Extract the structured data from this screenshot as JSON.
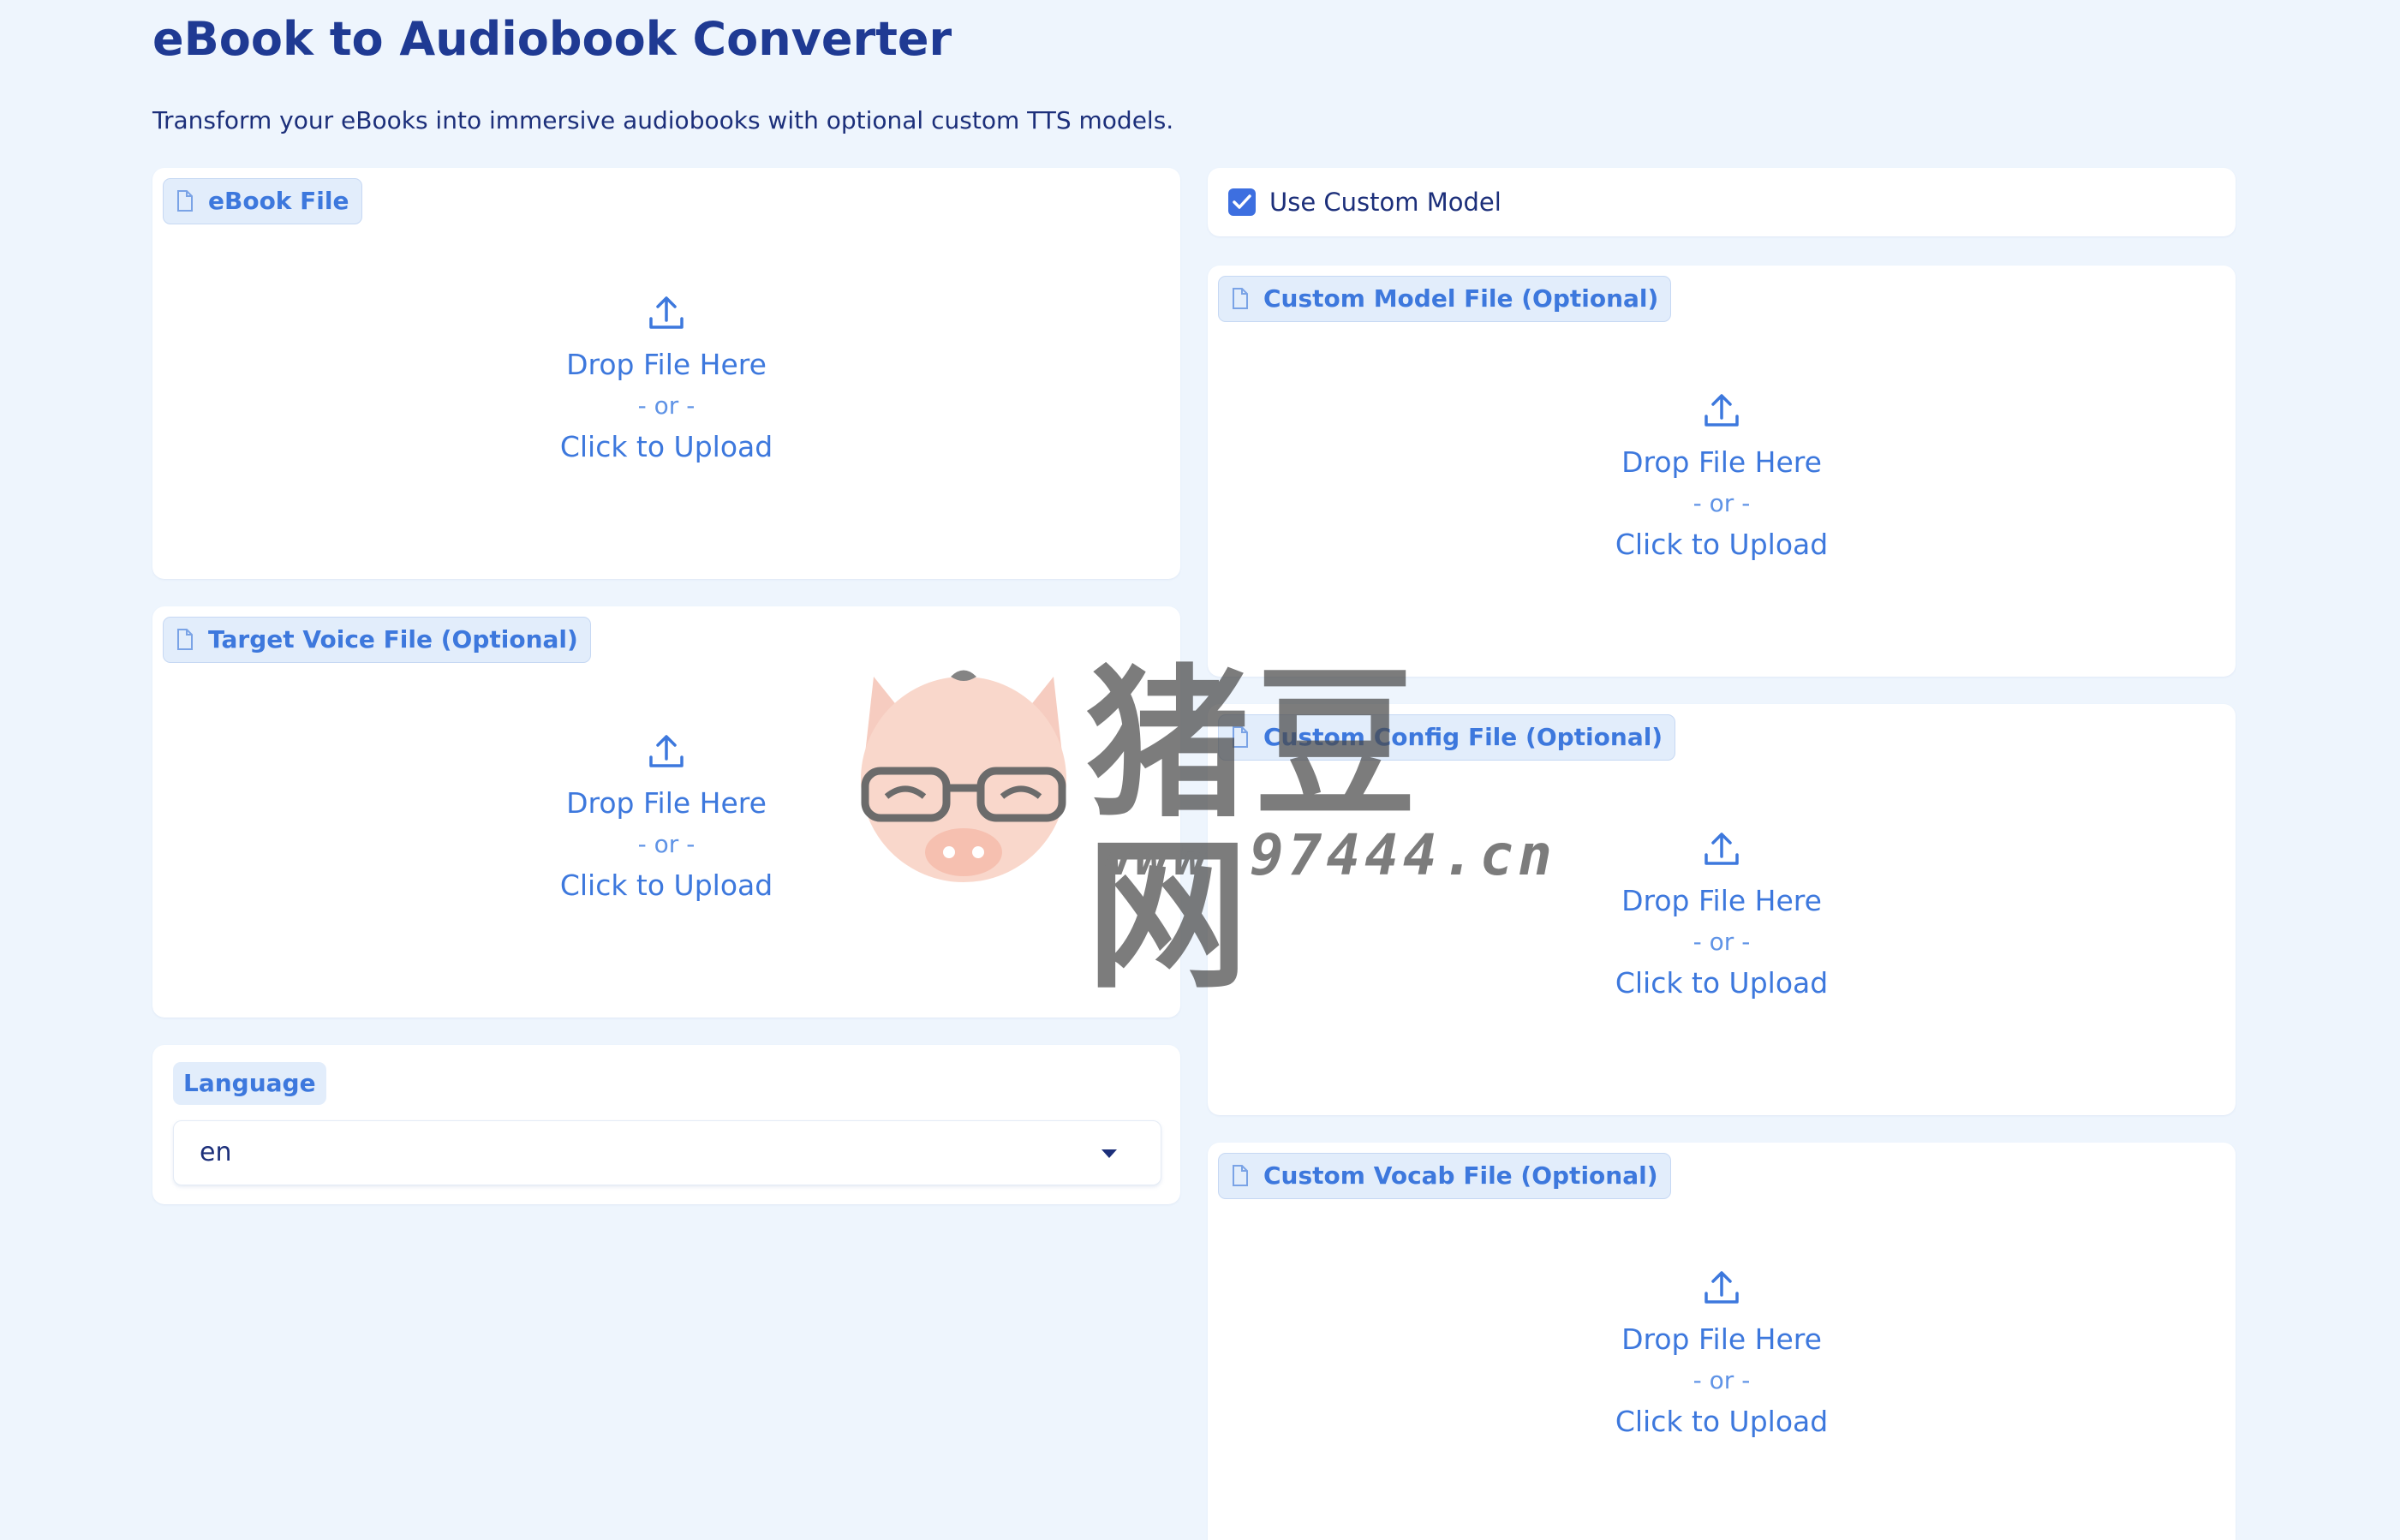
{
  "header": {
    "title": "eBook to Audiobook Converter",
    "subtitle": "Transform your eBooks into immersive audiobooks with optional custom TTS models."
  },
  "left": {
    "ebook": {
      "label": "eBook File",
      "drop_text": "Drop File Here",
      "or_text": "- or -",
      "upload_text": "Click to Upload"
    },
    "voice": {
      "label": "Target Voice File (Optional)",
      "drop_text": "Drop File Here",
      "or_text": "- or -",
      "upload_text": "Click to Upload"
    },
    "language": {
      "label": "Language",
      "value": "en"
    }
  },
  "right": {
    "use_custom_model": {
      "label": "Use Custom Model",
      "checked": true
    },
    "model": {
      "label": "Custom Model File (Optional)",
      "drop_text": "Drop File Here",
      "or_text": "- or -",
      "upload_text": "Click to Upload"
    },
    "config": {
      "label": "Custom Config File (Optional)",
      "drop_text": "Drop File Here",
      "or_text": "- or -",
      "upload_text": "Click to Upload"
    },
    "vocab": {
      "label": "Custom Vocab File (Optional)",
      "drop_text": "Drop File Here",
      "or_text": "- or -",
      "upload_text": "Click to Upload"
    }
  },
  "watermark": {
    "chinese_text": "猪豆网",
    "url": "www.97444.cn"
  },
  "colors": {
    "accent": "#3d78dd",
    "heading": "#1f3a93",
    "background": "#eef5fd",
    "checkbox": "#3d6fe0"
  }
}
